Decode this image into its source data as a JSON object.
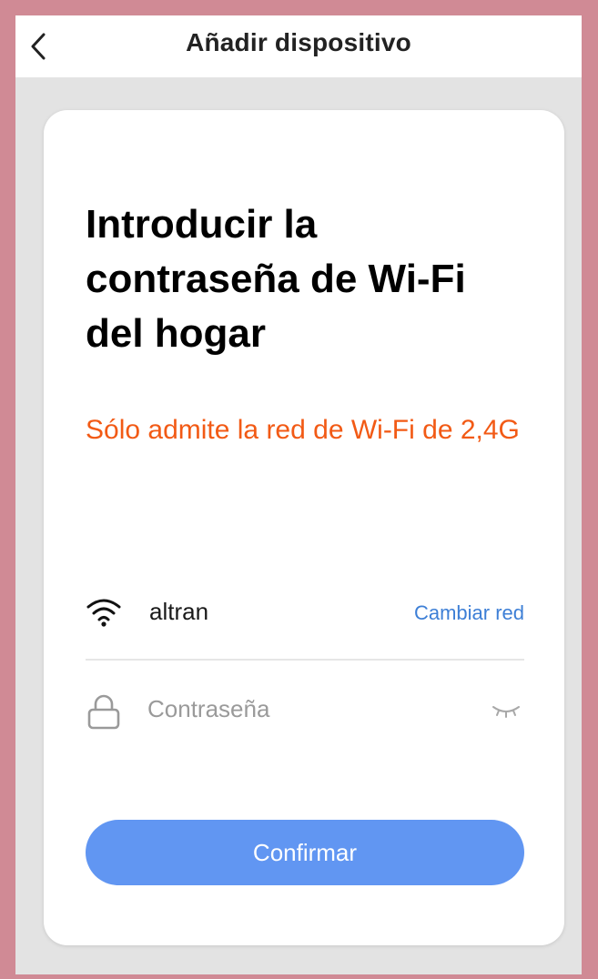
{
  "header": {
    "title": "Añadir dispositivo",
    "back_icon": "chevron-left-icon"
  },
  "main": {
    "heading": "Introducir la contraseña de Wi-Fi del hogar",
    "warning": "Sólo admite la red de Wi-Fi de 2,4G",
    "wifi": {
      "icon": "wifi-icon",
      "ssid": "altran",
      "change_label": "Cambiar red"
    },
    "password": {
      "icon": "lock-icon",
      "value": "",
      "placeholder": "Contraseña",
      "toggle_icon": "eye-closed-icon"
    },
    "confirm_label": "Confirmar"
  },
  "colors": {
    "frame": "#d08a95",
    "background": "#e3e3e3",
    "warning": "#f25a15",
    "link": "#3d7fd6",
    "button": "#6196f2"
  }
}
